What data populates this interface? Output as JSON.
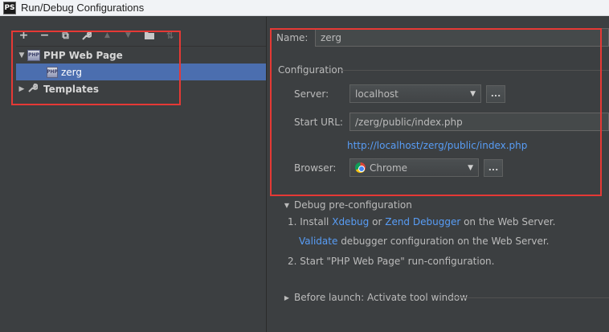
{
  "window": {
    "title": "Run/Debug Configurations",
    "logo_text": "PS"
  },
  "toolbar": {
    "buttons": [
      {
        "name": "add-button",
        "glyph": "+"
      },
      {
        "name": "remove-button",
        "glyph": "−"
      },
      {
        "name": "copy-button",
        "glyph": "⧉"
      },
      {
        "name": "edit-defaults-button",
        "glyph": "🔧"
      },
      {
        "name": "move-up-button",
        "glyph": "▲"
      },
      {
        "name": "move-down-button",
        "glyph": "▼"
      },
      {
        "name": "folder-button",
        "glyph": "📁"
      },
      {
        "name": "sort-button",
        "glyph": "⇅"
      }
    ]
  },
  "tree": {
    "group": {
      "label": "PHP Web Page",
      "icon": "php-icon",
      "expanded": true
    },
    "child": {
      "label": "zerg",
      "icon": "php-file-icon",
      "selected": true
    },
    "templates": {
      "label": "Templates",
      "icon": "wrench-icon"
    }
  },
  "form": {
    "name_label": "Name:",
    "name_value": "zerg",
    "section_title": "Configuration",
    "server_label": "Server:",
    "server_value": "localhost",
    "start_url_label": "Start URL:",
    "start_url_value": "/zerg/public/index.php",
    "resolved_url": "http://localhost/zerg/public/index.php",
    "browser_label": "Browser:",
    "browser_value": "Chrome",
    "dots": "..."
  },
  "debug": {
    "header": "Debug pre-configuration",
    "step1_prefix": "1. Install",
    "xdebug_link": "Xdebug",
    "or": "or",
    "zend_link": "Zend Debugger",
    "step1_suffix": "on the Web Server.",
    "validate_link": "Validate",
    "validate_suffix": "debugger configuration on the Web Server.",
    "step2": "2. Start \"PHP Web Page\" run-configuration."
  },
  "before_launch": {
    "label": "Before launch: Activate tool window"
  },
  "colors": {
    "accent_blue": "#4b6eaf",
    "link": "#589df6",
    "highlight_red": "#e53935"
  }
}
